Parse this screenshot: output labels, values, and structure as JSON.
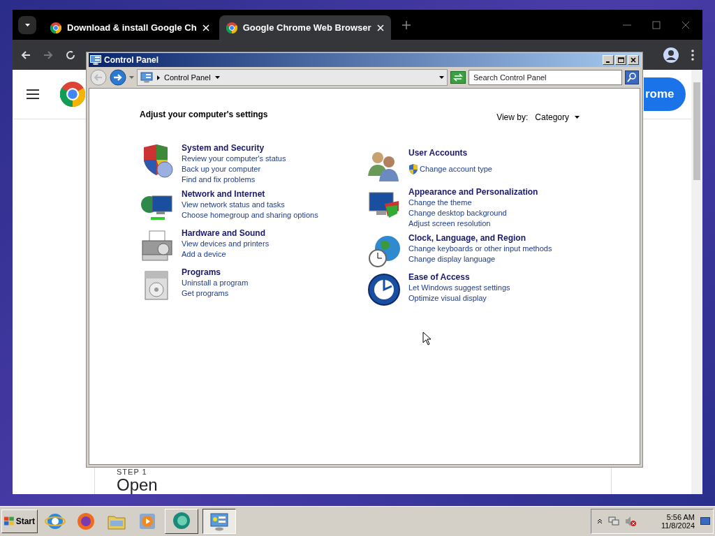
{
  "chrome": {
    "tabs": [
      {
        "title": "Download & install Google Ch",
        "selected": false
      },
      {
        "title": "Google Chrome Web Browser",
        "selected": true
      }
    ],
    "page": {
      "button": "rome",
      "step": "STEP 1",
      "heading": "Open"
    }
  },
  "control_panel": {
    "title": "Control Panel",
    "breadcrumb": "Control Panel",
    "search": {
      "placeholder": "Search Control Panel"
    },
    "heading": "Adjust your computer's settings",
    "view_by": {
      "label": "View by:",
      "value": "Category"
    },
    "columns": [
      [
        {
          "kind": "security",
          "title": "System and Security",
          "links": [
            {
              "text": "Review your computer's status",
              "shielded": false
            },
            {
              "text": "Back up your computer",
              "shielded": false
            },
            {
              "text": "Find and fix problems",
              "shielded": false
            }
          ]
        },
        {
          "kind": "network",
          "title": "Network and Internet",
          "links": [
            {
              "text": "View network status and tasks",
              "shielded": false
            },
            {
              "text": "Choose homegroup and sharing options",
              "shielded": false
            }
          ]
        },
        {
          "kind": "hardware",
          "title": "Hardware and Sound",
          "links": [
            {
              "text": "View devices and printers",
              "shielded": false
            },
            {
              "text": "Add a device",
              "shielded": false
            }
          ]
        },
        {
          "kind": "programs",
          "title": "Programs",
          "links": [
            {
              "text": "Uninstall a program",
              "shielded": false
            },
            {
              "text": "Get programs",
              "shielded": false
            }
          ]
        }
      ],
      [
        {
          "kind": "users",
          "title": "User Accounts",
          "links": [
            {
              "text": "Change account type",
              "shielded": true
            }
          ]
        },
        {
          "kind": "appearance",
          "title": "Appearance and Personalization",
          "links": [
            {
              "text": "Change the theme",
              "shielded": false
            },
            {
              "text": "Change desktop background",
              "shielded": false
            },
            {
              "text": "Adjust screen resolution",
              "shielded": false
            }
          ]
        },
        {
          "kind": "clock",
          "title": "Clock, Language, and Region",
          "links": [
            {
              "text": "Change keyboards or other input methods",
              "shielded": false
            },
            {
              "text": "Change display language",
              "shielded": false
            }
          ]
        },
        {
          "kind": "access",
          "title": "Ease of Access",
          "links": [
            {
              "text": "Let Windows suggest settings",
              "shielded": false
            },
            {
              "text": "Optimize visual display",
              "shielded": false
            }
          ]
        }
      ]
    ]
  },
  "taskbar": {
    "start": "Start",
    "apps": [
      {
        "kind": "ie",
        "selected": false
      },
      {
        "kind": "firefox",
        "selected": false
      },
      {
        "kind": "folder",
        "selected": false
      },
      {
        "kind": "media",
        "selected": false
      },
      {
        "kind": "chat",
        "selected": false
      },
      {
        "kind": "control",
        "selected": true
      }
    ],
    "clock": {
      "time": "5:56 AM",
      "date": "11/8/2024"
    }
  }
}
